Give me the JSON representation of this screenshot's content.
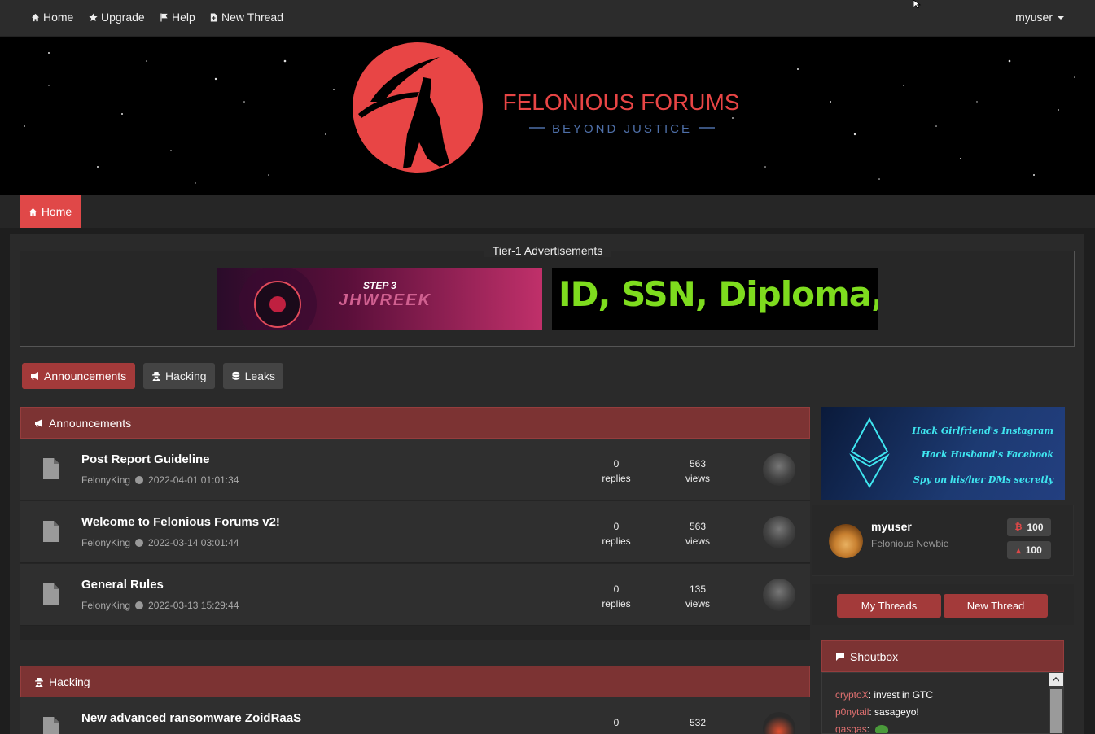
{
  "topnav": {
    "items": [
      {
        "label": "Home",
        "icon": "home-icon"
      },
      {
        "label": "Upgrade",
        "icon": "star-icon"
      },
      {
        "label": "Help",
        "icon": "flag-icon"
      },
      {
        "label": "New Thread",
        "icon": "file-plus-icon"
      }
    ],
    "user": "myuser"
  },
  "banner": {
    "title": "FELONIOUS FORUMS",
    "tagline": "BEYOND JUSTICE",
    "accent": "#e84545",
    "tagline_color": "#4e6fa8"
  },
  "breadcrumb": {
    "home_label": "Home"
  },
  "ads": {
    "legend": "Tier-1 Advertisements",
    "ad1_text_top": "STEP 3",
    "ad1_text_main": "JHWREEK",
    "ad2_text": "ID, SSN, Diploma, D"
  },
  "tabs": [
    {
      "label": "Announcements",
      "icon": "megaphone-icon",
      "active": true
    },
    {
      "label": "Hacking",
      "icon": "user-secret-icon",
      "active": false
    },
    {
      "label": "Leaks",
      "icon": "database-icon",
      "active": false
    }
  ],
  "announcements": {
    "title": "Announcements",
    "threads": [
      {
        "title": "Post Report Guideline",
        "author": "FelonyKing",
        "date": "2022-04-01 01:01:34",
        "replies": "0",
        "replies_label": "replies",
        "views": "563",
        "views_label": "views"
      },
      {
        "title": "Welcome to Felonious Forums v2!",
        "author": "FelonyKing",
        "date": "2022-03-14 03:01:44",
        "replies": "0",
        "replies_label": "replies",
        "views": "563",
        "views_label": "views"
      },
      {
        "title": "General Rules",
        "author": "FelonyKing",
        "date": "2022-03-13 15:29:44",
        "replies": "0",
        "replies_label": "replies",
        "views": "135",
        "views_label": "views"
      }
    ]
  },
  "hacking": {
    "title": "Hacking",
    "threads": [
      {
        "title": "New advanced ransomware ZoidRaaS",
        "replies": "0",
        "views": "532"
      }
    ]
  },
  "side_ad": {
    "lines": [
      "Hack Girlfriend's Instagram",
      "Hack Husband's Facebook",
      "Spy on his/her DMs secretly"
    ]
  },
  "profile": {
    "name": "myuser",
    "rank": "Felonious Newbie",
    "btc": "100",
    "rep": "100"
  },
  "buttons": {
    "my_threads": "My Threads",
    "new_thread": "New Thread"
  },
  "shoutbox": {
    "title": "Shoutbox",
    "messages": [
      {
        "user": "cryptoX",
        "text": "invest in GTC"
      },
      {
        "user": "p0nytail",
        "text": "sasageyo!"
      },
      {
        "user": "gasgas",
        "text": ""
      }
    ]
  },
  "colors": {
    "accent": "#e04848",
    "section_header": "#7c3333",
    "button": "#a33a3a"
  }
}
